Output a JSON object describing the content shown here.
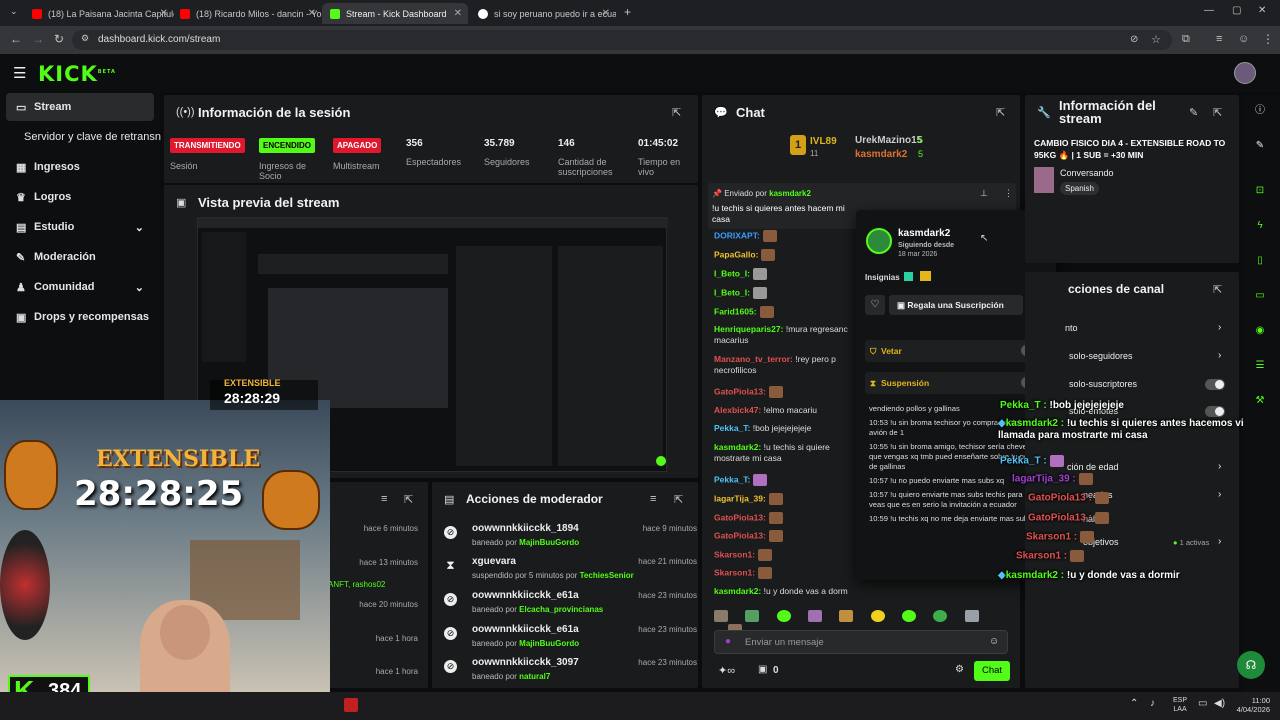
{
  "browser": {
    "tabs": [
      {
        "label": "(18) La Paisana Jacinta Capitulo",
        "color": "#ff0000"
      },
      {
        "label": "(18) Ricardo Milos - dancin - Yo",
        "color": "#ff0000"
      },
      {
        "label": "Stream - Kick Dashboard",
        "color": "#53fc18"
      },
      {
        "label": "si soy peruano puedo ir a ecuad",
        "color": "#ffffff"
      }
    ],
    "url": "dashboard.kick.com/stream"
  },
  "header": {
    "logo": "KICK",
    "logo_sup": "BETA"
  },
  "sidebar": {
    "items": [
      {
        "label": "Stream",
        "icon": "stream-icon"
      },
      {
        "label": "Servidor y clave de retransn",
        "icon": ""
      },
      {
        "label": "Ingresos",
        "icon": "revenue-icon"
      },
      {
        "label": "Logros",
        "icon": "trophy-icon"
      },
      {
        "label": "Estudio",
        "icon": "studio-icon"
      },
      {
        "label": "Moderación",
        "icon": "moderation-icon"
      },
      {
        "label": "Comunidad",
        "icon": "community-icon"
      },
      {
        "label": "Drops y recompensas",
        "icon": "gift-icon"
      }
    ]
  },
  "session": {
    "title": "Información de la sesión",
    "badges": [
      {
        "label": "TRANSMITIENDO",
        "caption": "Sesión",
        "bg": "#e0182d"
      },
      {
        "label": "ENCENDIDO",
        "caption": "Ingresos de Socio",
        "bg": "#53fc18"
      },
      {
        "label": "APAGADO",
        "caption": "Multistream",
        "bg": "#e0182d"
      }
    ],
    "stats": [
      {
        "value": "356",
        "caption": "Espectadores"
      },
      {
        "value": "35.789",
        "caption": "Seguidores"
      },
      {
        "value": "146",
        "caption": "Cantidad de suscripciones"
      },
      {
        "value": "01:45:02",
        "caption": "Tiempo en vivo"
      }
    ]
  },
  "preview": {
    "title": "Vista previa del stream"
  },
  "overlay": {
    "extensible": "EXTENSIBLE",
    "timer": "28:28:25",
    "small_timer": "28:28:29",
    "viewer_count": "384",
    "kick_letter": "K"
  },
  "activity_times": [
    "hace 6 minutos",
    "hace 13 minutos",
    "hace 20 minutos",
    "hace 1 hora",
    "hace 1 hora"
  ],
  "activity_fragment": "ANFT, rashos02",
  "modactions": {
    "title": "Acciones de moderador",
    "rows": [
      {
        "user": "oowwnnkkiicckk_1894",
        "action": "baneado por",
        "by": "MajinBuuGordo",
        "time": "hace 9 minutos",
        "icon": "ban-icon",
        "glyph": "⊘"
      },
      {
        "user": "xguevara",
        "action": "suspendido por 5 minutos por",
        "by": "TechiesSenior",
        "time": "hace 21 minutos",
        "icon": "hourglass-icon",
        "glyph": "⧗"
      },
      {
        "user": "oowwnnkkiicckk_e61a",
        "action": "baneado por",
        "by": "Elcacha_provincianas",
        "time": "hace 23 minutos",
        "icon": "ban-icon",
        "glyph": "⊘"
      },
      {
        "user": "oowwnnkkiicckk_e61a",
        "action": "baneado por",
        "by": "MajinBuuGordo",
        "time": "hace 23 minutos",
        "icon": "ban-icon",
        "glyph": "⊘"
      },
      {
        "user": "oowwnnkkiicckk_3097",
        "action": "baneado por",
        "by": "natural7",
        "time": "hace 23 minutos",
        "icon": "ban-icon",
        "glyph": "⊘"
      }
    ]
  },
  "chat": {
    "title": "Chat",
    "top_gifters": [
      {
        "name": "IVL89",
        "count": "11"
      },
      {
        "name": "UrekMazino15",
        "count": "5"
      },
      {
        "name": "kasmdark2",
        "count": "5"
      }
    ],
    "pinned": {
      "label": "Enviado por",
      "user": "kasmdark2",
      "text": "!u techis si quieres antes hacem mi casa"
    },
    "lines": [
      {
        "user": "DORIXAPT:",
        "text": ""
      },
      {
        "user": "PapaGallo:",
        "text": ""
      },
      {
        "user": "I_Beto_I:",
        "text": ""
      },
      {
        "user": "I_Beto_I:",
        "text": ""
      },
      {
        "user": "Farid1605:",
        "text": ""
      },
      {
        "user": "Henriqueparis27:",
        "text": "!mura regresanc macarius"
      },
      {
        "user": "Manzano_tv_terror:",
        "text": "!rey pero p necrofilicos"
      },
      {
        "user": "GatoPiola13:",
        "text": ""
      },
      {
        "user": "Alexbick47:",
        "text": "!elmo macariu"
      },
      {
        "user": "Pekka_T:",
        "text": "!bob jejejejejeje"
      },
      {
        "user": "kasmdark2:",
        "text": "!u techis si quiere mostrarte mi casa"
      },
      {
        "user": "Pekka_T:",
        "text": ""
      },
      {
        "user": "lagarTija_39:",
        "text": ""
      },
      {
        "user": "GatoPiola13:",
        "text": ""
      },
      {
        "user": "GatoPiola13:",
        "text": ""
      },
      {
        "user": "Skarson1:",
        "text": ""
      },
      {
        "user": "Skarson1:",
        "text": ""
      },
      {
        "user": "kasmdark2:",
        "text": "!u y donde vas a dorm"
      }
    ],
    "input_placeholder": "Enviar un mensaje",
    "points": "0",
    "send_label": "Chat"
  },
  "user_card": {
    "name": "kasmdark2",
    "following_label": "Siguiendo desde",
    "following_date": "18 mar 2026",
    "badges_label": "Insignias",
    "gift_label": "Regala una Suscripción",
    "ban_label": "Vetar",
    "timeout_label": "Suspensión",
    "history": [
      "vendiendo pollos y gallinas",
      "10:53 !u sin broma techisor yo comprar el ticket de avión de 1",
      "10:55 !u sin broma amigo, techisor sería chevere que vengas xq tmb pued enseñarte sobre tu negocio de gallinas",
      "10:57 !u no puedo enviarte mas subs xq",
      "10:57 !u quiero enviarte mas subs techis para que veas que es en serio la invitación a ecuador",
      "10:59 !u techis xq no me deja enviarte mas subs ?"
    ]
  },
  "stream_info": {
    "title": "Información del stream",
    "stream_title": "CAMBIO FISICO DIA 4 - EXTENSIBLE ROAD TO 95KG 🔥 | 1 SUB = +30 MIN",
    "category": "Conversando",
    "language": "Spanish"
  },
  "channel_actions": {
    "title": "cciones de canal",
    "items": [
      {
        "label": "nto",
        "control": "chevron"
      },
      {
        "label": "solo-seguidores",
        "control": "chevron"
      },
      {
        "label": "solo-suscriptores",
        "control": "toggle"
      },
      {
        "label": "solo-emotes",
        "control": "toggle"
      },
      {
        "label": "ción de edad",
        "control": "chevron"
      },
      {
        "label": "neadas",
        "control": "chevron"
      },
      {
        "label": "nal",
        "control": "none"
      },
      {
        "label": "objetivos",
        "control": "chevron"
      }
    ],
    "active_label": "1 activas"
  },
  "chat_overlay": [
    {
      "user": "Pekka_T :",
      "text": "!bob jejejejejeje"
    },
    {
      "user": "kasmdark2 :",
      "text": "!u techis si quieres antes hacemos video llamada para mostrarte mi casa"
    },
    {
      "user": "Pekka_T :",
      "text": ""
    },
    {
      "user": "lagarTija_39 :",
      "text": ""
    },
    {
      "user": "GatoPiola13 :",
      "text": ""
    },
    {
      "user": "GatoPiola13 :",
      "text": ""
    },
    {
      "user": "Skarson1 :",
      "text": ""
    },
    {
      "user": "Skarson1 :",
      "text": ""
    },
    {
      "user": "kasmdark2 :",
      "text": "!u y donde vas a dormir"
    }
  ],
  "taskbar": {
    "lang1": "ESP",
    "lang2": "LAA",
    "time": "11:00",
    "date": "4/04/2026"
  }
}
